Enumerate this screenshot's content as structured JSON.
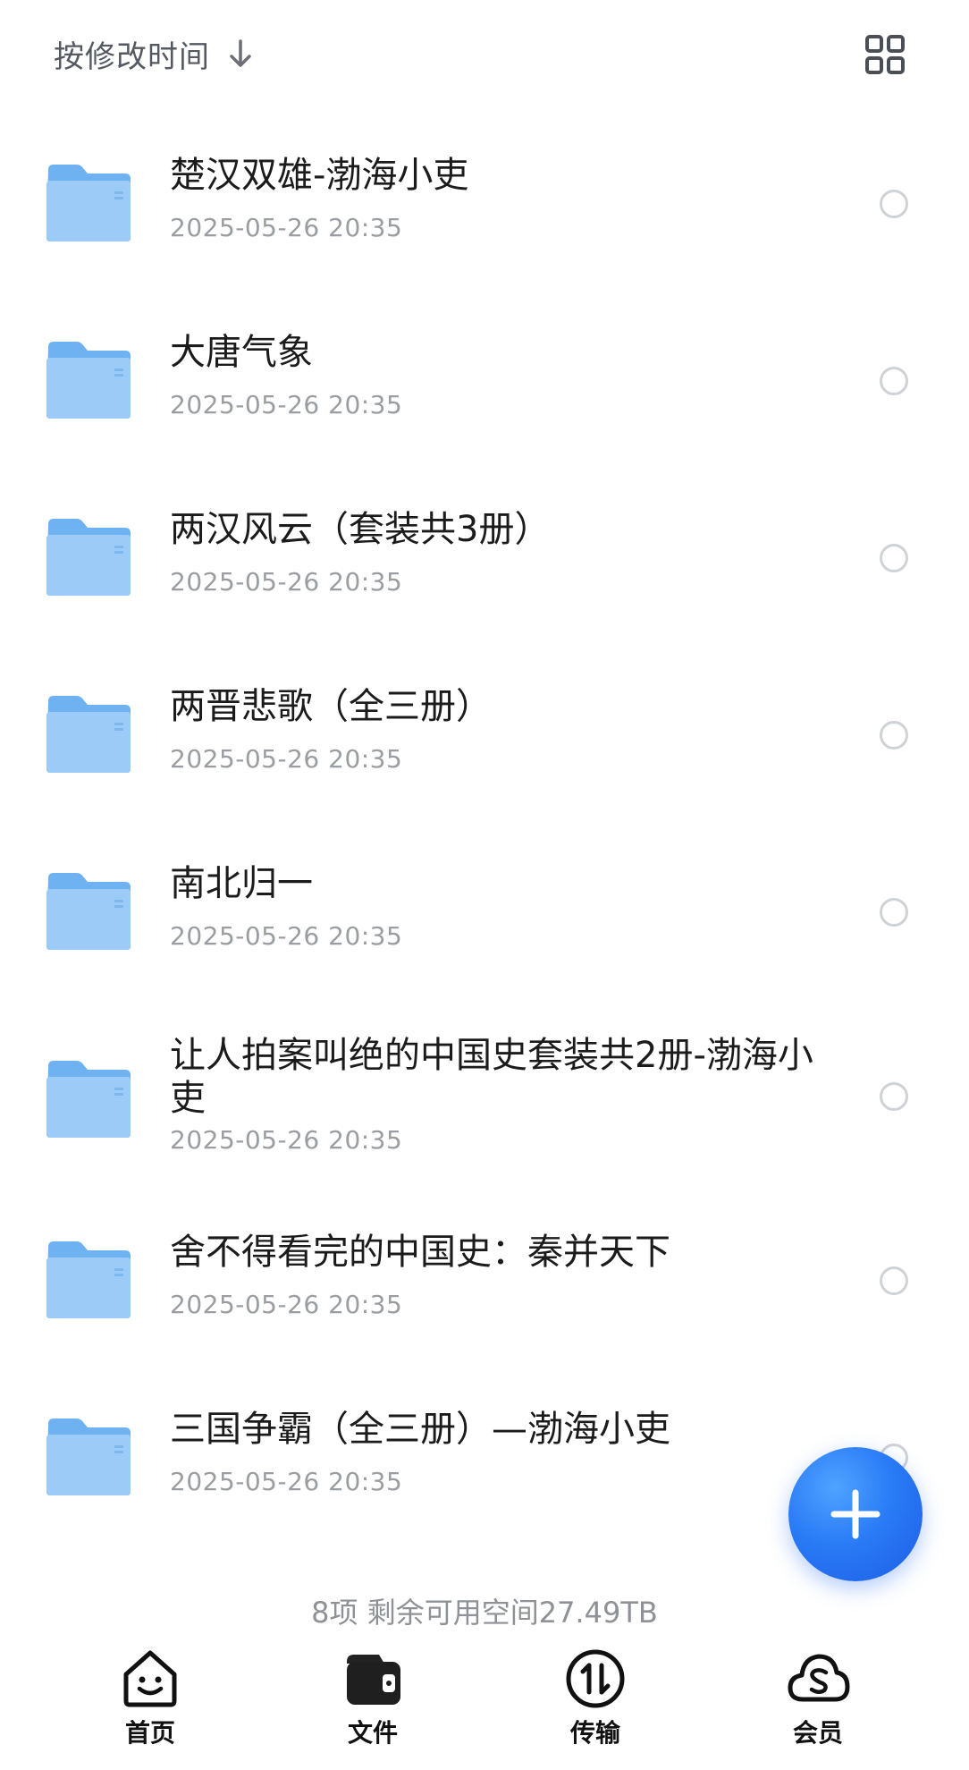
{
  "header": {
    "sort_label": "按修改时间",
    "sort_icon": "arrow-down-icon",
    "view_toggle_icon": "grid-view-icon"
  },
  "files": [
    {
      "name": "楚汉双雄-渤海小吏",
      "date": "2025-05-26 20:35"
    },
    {
      "name": "大唐气象",
      "date": "2025-05-26 20:35"
    },
    {
      "name": "两汉风云（套装共3册）",
      "date": "2025-05-26 20:35"
    },
    {
      "name": "两晋悲歌（全三册）",
      "date": "2025-05-26 20:35"
    },
    {
      "name": "南北归一",
      "date": "2025-05-26 20:35"
    },
    {
      "name": "让人拍案叫绝的中国史套装共2册-渤海小吏",
      "date": "2025-05-26 20:35"
    },
    {
      "name": "舍不得看完的中国史：秦并天下",
      "date": "2025-05-26 20:35"
    },
    {
      "name": "三国争霸（全三册）—渤海小吏",
      "date": "2025-05-26 20:35"
    }
  ],
  "footer": {
    "storage_info": "8项 剩余可用空间27.49TB"
  },
  "nav": [
    {
      "label": "首页",
      "icon": "home-smile-icon"
    },
    {
      "label": "文件",
      "icon": "files-wallet-icon"
    },
    {
      "label": "传输",
      "icon": "transfer-icon"
    },
    {
      "label": "会员",
      "icon": "cloud-membership-icon"
    }
  ],
  "colors": {
    "accent": "#2a7bf6",
    "folder": "#7dbcf5",
    "secondary_text": "#9a9da2"
  }
}
